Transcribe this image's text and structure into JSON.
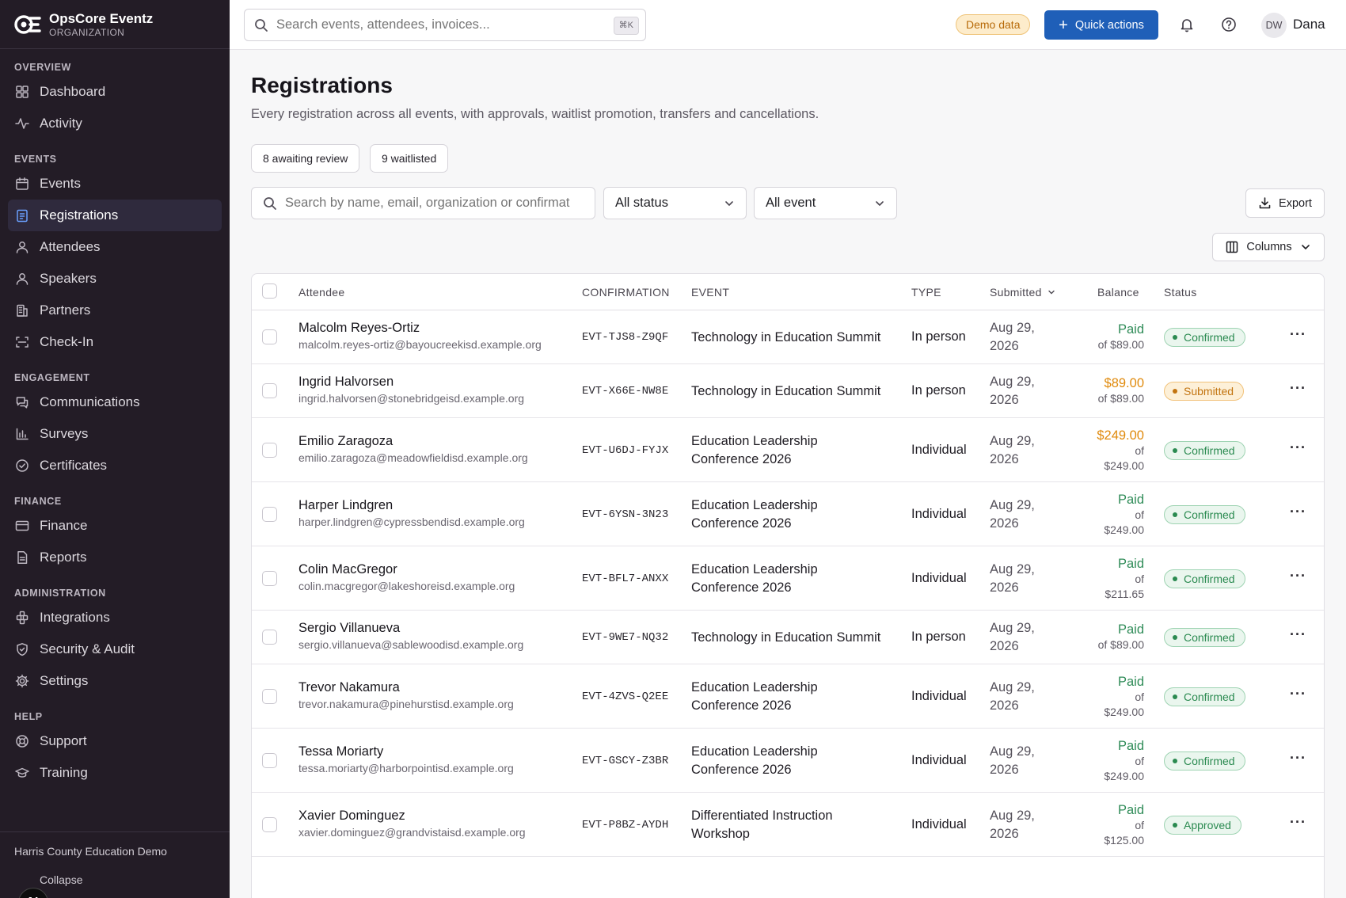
{
  "brand": {
    "name": "OpsCore Eventz",
    "subtitle": "ORGANIZATION"
  },
  "sidebar": {
    "sections": [
      {
        "title": "OVERVIEW",
        "items": [
          {
            "label": "Dashboard",
            "icon": "grid-icon"
          },
          {
            "label": "Activity",
            "icon": "activity-icon"
          }
        ]
      },
      {
        "title": "EVENTS",
        "items": [
          {
            "label": "Events",
            "icon": "calendar-icon"
          },
          {
            "label": "Registrations",
            "icon": "clipboard-icon",
            "active": true
          },
          {
            "label": "Attendees",
            "icon": "user-icon"
          },
          {
            "label": "Speakers",
            "icon": "user-icon"
          },
          {
            "label": "Partners",
            "icon": "building-icon"
          },
          {
            "label": "Check-In",
            "icon": "scan-icon"
          }
        ]
      },
      {
        "title": "ENGAGEMENT",
        "items": [
          {
            "label": "Communications",
            "icon": "chat-icon"
          },
          {
            "label": "Surveys",
            "icon": "bar-chart-icon"
          },
          {
            "label": "Certificates",
            "icon": "check-circle-icon"
          }
        ]
      },
      {
        "title": "FINANCE",
        "items": [
          {
            "label": "Finance",
            "icon": "card-icon"
          },
          {
            "label": "Reports",
            "icon": "document-icon"
          }
        ]
      },
      {
        "title": "ADMINISTRATION",
        "items": [
          {
            "label": "Integrations",
            "icon": "puzzle-icon"
          },
          {
            "label": "Security & Audit",
            "icon": "shield-icon"
          },
          {
            "label": "Settings",
            "icon": "gear-icon"
          }
        ]
      },
      {
        "title": "HELP",
        "items": [
          {
            "label": "Support",
            "icon": "lifebuoy-icon"
          },
          {
            "label": "Training",
            "icon": "cap-icon"
          }
        ]
      }
    ],
    "org_name": "Harris County Education Demo",
    "collapse_label": "Collapse",
    "n_badge": "N"
  },
  "topbar": {
    "search_placeholder": "Search events, attendees, invoices...",
    "search_shortcut": "⌘K",
    "demo_label": "Demo data",
    "quick_actions_label": "Quick actions",
    "avatar_initials": "DW",
    "user_name": "Dana"
  },
  "page": {
    "title": "Registrations",
    "subtitle": "Every registration across all events, with approvals, waitlist promotion, transfers and cancellations.",
    "chips": [
      "8 awaiting review",
      "9 waitlisted"
    ],
    "filter_placeholder": "Search by name, email, organization or confirmat",
    "status_select": "All status",
    "event_select": "All event",
    "export_label": "Export",
    "columns_label": "Columns"
  },
  "table": {
    "headers": {
      "attendee": "Attendee",
      "confirmation": "CONFIRMATION",
      "event": "EVENT",
      "type": "TYPE",
      "submitted": "Submitted",
      "balance": "Balance",
      "status": "Status"
    },
    "rows": [
      {
        "name": "Malcolm Reyes-Ortiz",
        "email": "malcolm.reyes-ortiz@bayoucreekisd.example.org",
        "confirmation": "EVT-TJS8-Z9QF",
        "event": "Technology in Education Summit",
        "type": "In person",
        "date_line1": "Aug 29,",
        "date_line2": "2026",
        "balance": "Paid",
        "balance_state": "paid",
        "balance_of": "of $89.00",
        "status": "Confirmed",
        "status_color": "green"
      },
      {
        "name": "Ingrid Halvorsen",
        "email": "ingrid.halvorsen@stonebridgeisd.example.org",
        "confirmation": "EVT-X66E-NW8E",
        "event": "Technology in Education Summit",
        "type": "In person",
        "date_line1": "Aug 29,",
        "date_line2": "2026",
        "balance": "$89.00",
        "balance_state": "due",
        "balance_of": "of $89.00",
        "status": "Submitted",
        "status_color": "amber"
      },
      {
        "name": "Emilio Zaragoza",
        "email": "emilio.zaragoza@meadowfieldisd.example.org",
        "confirmation": "EVT-U6DJ-FYJX",
        "event": "Education Leadership Conference 2026",
        "type": "Individual",
        "date_line1": "Aug 29,",
        "date_line2": "2026",
        "balance": "$249.00",
        "balance_state": "due",
        "balance_of": "of $249.00",
        "status": "Confirmed",
        "status_color": "green"
      },
      {
        "name": "Harper Lindgren",
        "email": "harper.lindgren@cypressbendisd.example.org",
        "confirmation": "EVT-6YSN-3N23",
        "event": "Education Leadership Conference 2026",
        "type": "Individual",
        "date_line1": "Aug 29,",
        "date_line2": "2026",
        "balance": "Paid",
        "balance_state": "paid",
        "balance_of": "of $249.00",
        "status": "Confirmed",
        "status_color": "green"
      },
      {
        "name": "Colin MacGregor",
        "email": "colin.macgregor@lakeshoreisd.example.org",
        "confirmation": "EVT-BFL7-ANXX",
        "event": "Education Leadership Conference 2026",
        "type": "Individual",
        "date_line1": "Aug 29,",
        "date_line2": "2026",
        "balance": "Paid",
        "balance_state": "paid",
        "balance_of": "of $211.65",
        "status": "Confirmed",
        "status_color": "green"
      },
      {
        "name": "Sergio Villanueva",
        "email": "sergio.villanueva@sablewoodisd.example.org",
        "confirmation": "EVT-9WE7-NQ32",
        "event": "Technology in Education Summit",
        "type": "In person",
        "date_line1": "Aug 29,",
        "date_line2": "2026",
        "balance": "Paid",
        "balance_state": "paid",
        "balance_of": "of $89.00",
        "status": "Confirmed",
        "status_color": "green"
      },
      {
        "name": "Trevor Nakamura",
        "email": "trevor.nakamura@pinehurstisd.example.org",
        "confirmation": "EVT-4ZVS-Q2EE",
        "event": "Education Leadership Conference 2026",
        "type": "Individual",
        "date_line1": "Aug 29,",
        "date_line2": "2026",
        "balance": "Paid",
        "balance_state": "paid",
        "balance_of": "of $249.00",
        "status": "Confirmed",
        "status_color": "green"
      },
      {
        "name": "Tessa Moriarty",
        "email": "tessa.moriarty@harborpointisd.example.org",
        "confirmation": "EVT-GSCY-Z3BR",
        "event": "Education Leadership Conference 2026",
        "type": "Individual",
        "date_line1": "Aug 29,",
        "date_line2": "2026",
        "balance": "Paid",
        "balance_state": "paid",
        "balance_of": "of $249.00",
        "status": "Confirmed",
        "status_color": "green"
      },
      {
        "name": "Xavier Dominguez",
        "email": "xavier.dominguez@grandvistaisd.example.org",
        "confirmation": "EVT-P8BZ-AYDH",
        "event": "Differentiated Instruction Workshop",
        "type": "Individual",
        "date_line1": "Aug 29,",
        "date_line2": "2026",
        "balance": "Paid",
        "balance_state": "paid",
        "balance_of": "of $125.00",
        "status": "Approved",
        "status_color": "green"
      }
    ]
  }
}
